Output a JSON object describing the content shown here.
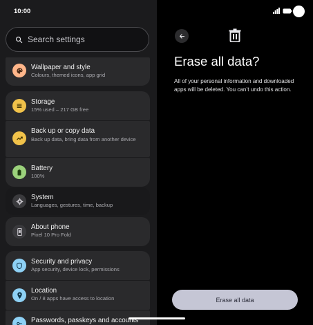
{
  "status_bar": {
    "time": "10:00"
  },
  "search": {
    "placeholder": "Search settings"
  },
  "settings_items": [
    {
      "title": "Wallpaper and style",
      "subtitle": "Colours, themed icons, app grid",
      "icon": "palette-icon",
      "color": "#ffb68a"
    },
    {
      "title": "Storage",
      "subtitle": "15% used – 217 GB free",
      "icon": "storage-icon",
      "color": "#f1c24a"
    },
    {
      "title": "Back up or copy data",
      "subtitle": "Back up data, bring data from another device",
      "icon": "backup-icon",
      "color": "#f1c24a"
    },
    {
      "title": "Battery",
      "subtitle": "100%",
      "icon": "battery-icon",
      "color": "#9bd17b"
    },
    {
      "title": "System",
      "subtitle": "Languages, gestures, time, backup",
      "icon": "gear-icon",
      "color": "#c9c6cc"
    },
    {
      "title": "About phone",
      "subtitle": "Pixel 10 Pro Fold",
      "icon": "phone-icon",
      "color": "#c9c6cc"
    },
    {
      "title": "Security and privacy",
      "subtitle": "App security, device lock, permissions",
      "icon": "shield-icon",
      "color": "#8ed1f5"
    },
    {
      "title": "Location",
      "subtitle": "On / 8 apps have access to location",
      "icon": "location-icon",
      "color": "#8ed1f5"
    },
    {
      "title": "Passwords, passkeys and accounts",
      "subtitle": "",
      "icon": "key-icon",
      "color": "#8ed1f5"
    }
  ],
  "detail": {
    "title": "Erase all data?",
    "body": "All of your personal information and downloaded apps will be deleted. You can’t undo this action.",
    "action_label": "Erase all data"
  }
}
